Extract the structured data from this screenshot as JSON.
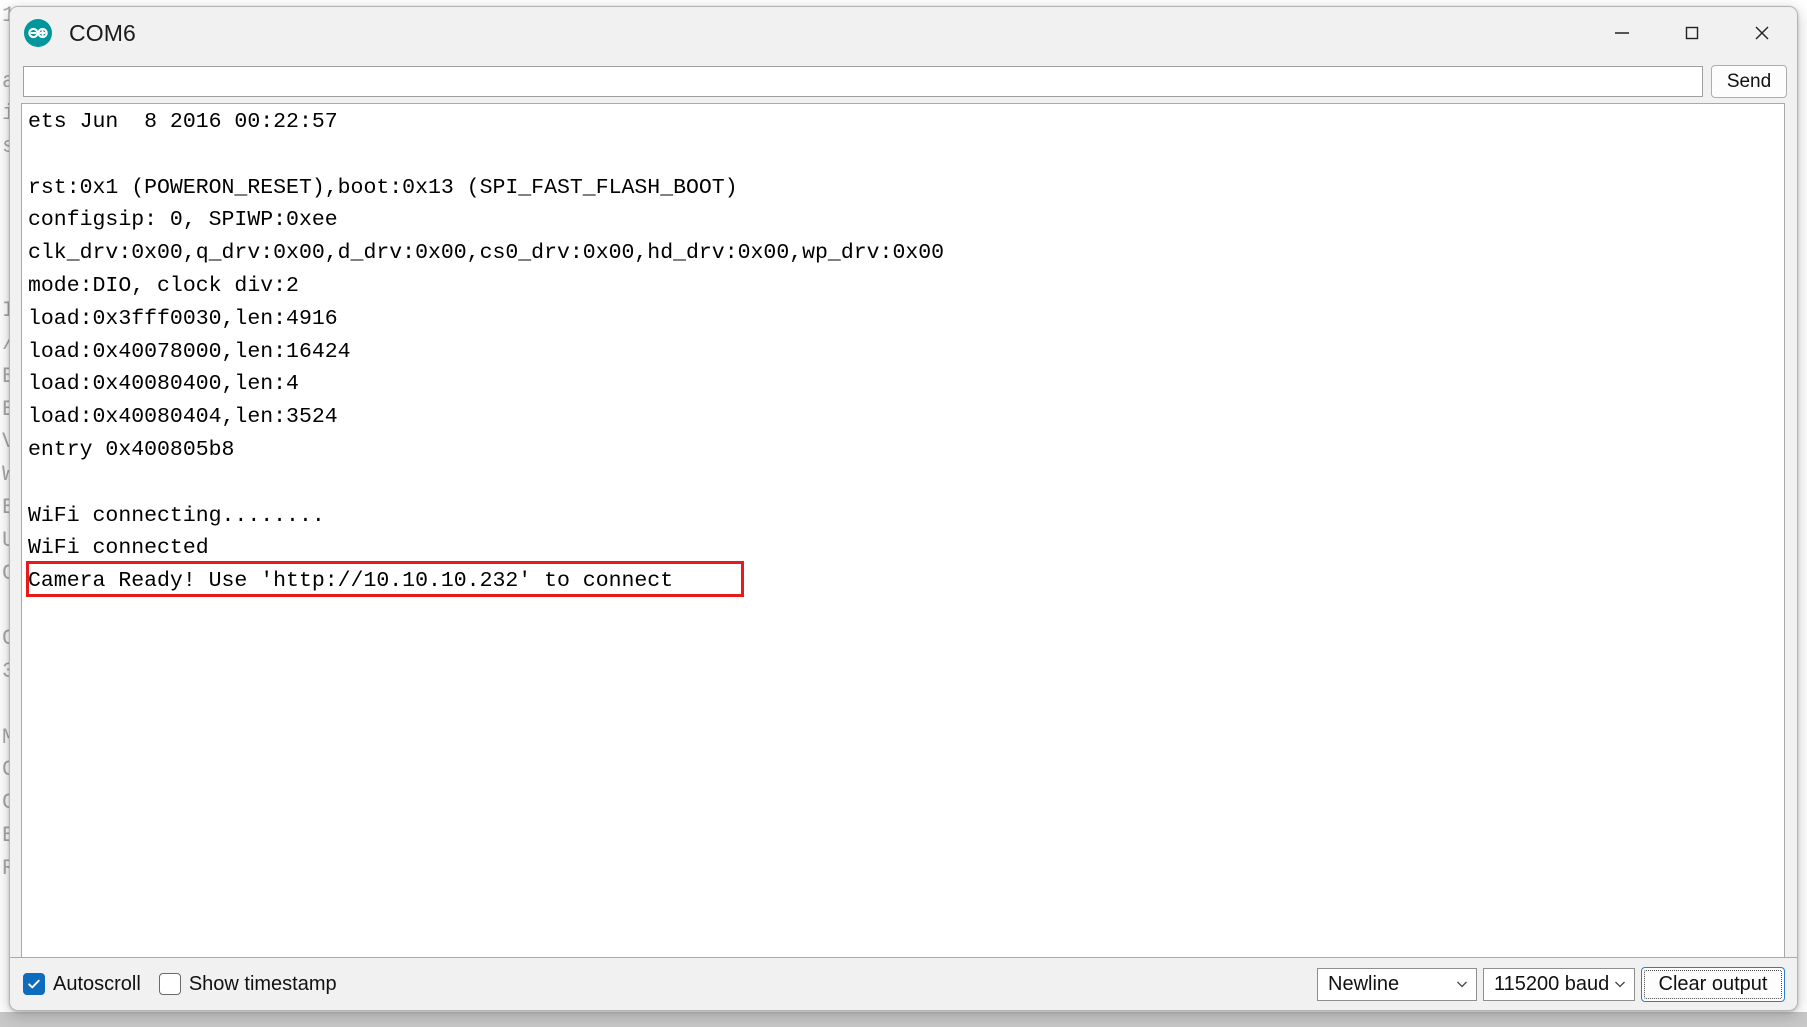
{
  "window": {
    "title": "COM6",
    "app_icon": "arduino-infinity-icon",
    "controls": {
      "minimize": "minimize-icon",
      "maximize": "maximize-icon",
      "close": "close-icon"
    }
  },
  "send_row": {
    "input_value": "",
    "input_placeholder": "",
    "send_label": "Send"
  },
  "console": {
    "lines": [
      "ets Jun  8 2016 00:22:57",
      "",
      "rst:0x1 (POWERON_RESET),boot:0x13 (SPI_FAST_FLASH_BOOT)",
      "configsip: 0, SPIWP:0xee",
      "clk_drv:0x00,q_drv:0x00,d_drv:0x00,cs0_drv:0x00,hd_drv:0x00,wp_drv:0x00",
      "mode:DIO, clock div:2",
      "load:0x3fff0030,len:4916",
      "load:0x40078000,len:16424",
      "load:0x40080400,len:4",
      "load:0x40080404,len:3524",
      "entry 0x400805b8",
      "",
      "WiFi connecting........",
      "WiFi connected",
      "Camera Ready! Use 'http://10.10.10.232' to connect"
    ],
    "highlighted_line_index": 14,
    "highlight_color": "#e81a1a"
  },
  "statusbar": {
    "autoscroll_label": "Autoscroll",
    "autoscroll_checked": true,
    "show_timestamp_label": "Show timestamp",
    "show_timestamp_checked": false,
    "line_ending": "Newline",
    "baud_rate": "115200 baud",
    "clear_output_label": "Clear output",
    "focus_accent": "#2f7ad1",
    "checkbox_accent": "#0f6cbd"
  },
  "backdrop": {
    "code_lines": [
      "1",
      "",
      "a",
      "i",
      "s",
      "",
      "",
      "",
      "",
      "I",
      "/",
      "E",
      "E",
      "V",
      "W",
      "E",
      "U",
      "C",
      "",
      "C",
      "3",
      "",
      "M",
      "C",
      "C",
      "E",
      "R"
    ]
  }
}
